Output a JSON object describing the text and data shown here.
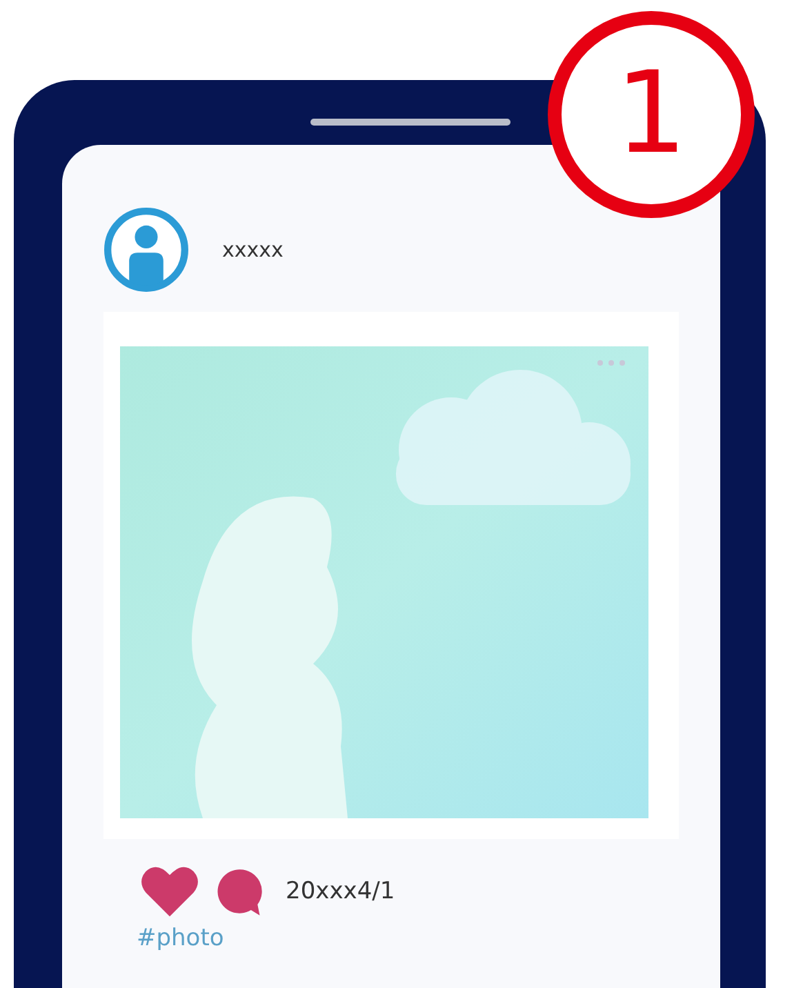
{
  "step_badge": "1",
  "post": {
    "username": "xxxxx",
    "date": "20xxx4/1",
    "hashtag": "#photo"
  }
}
